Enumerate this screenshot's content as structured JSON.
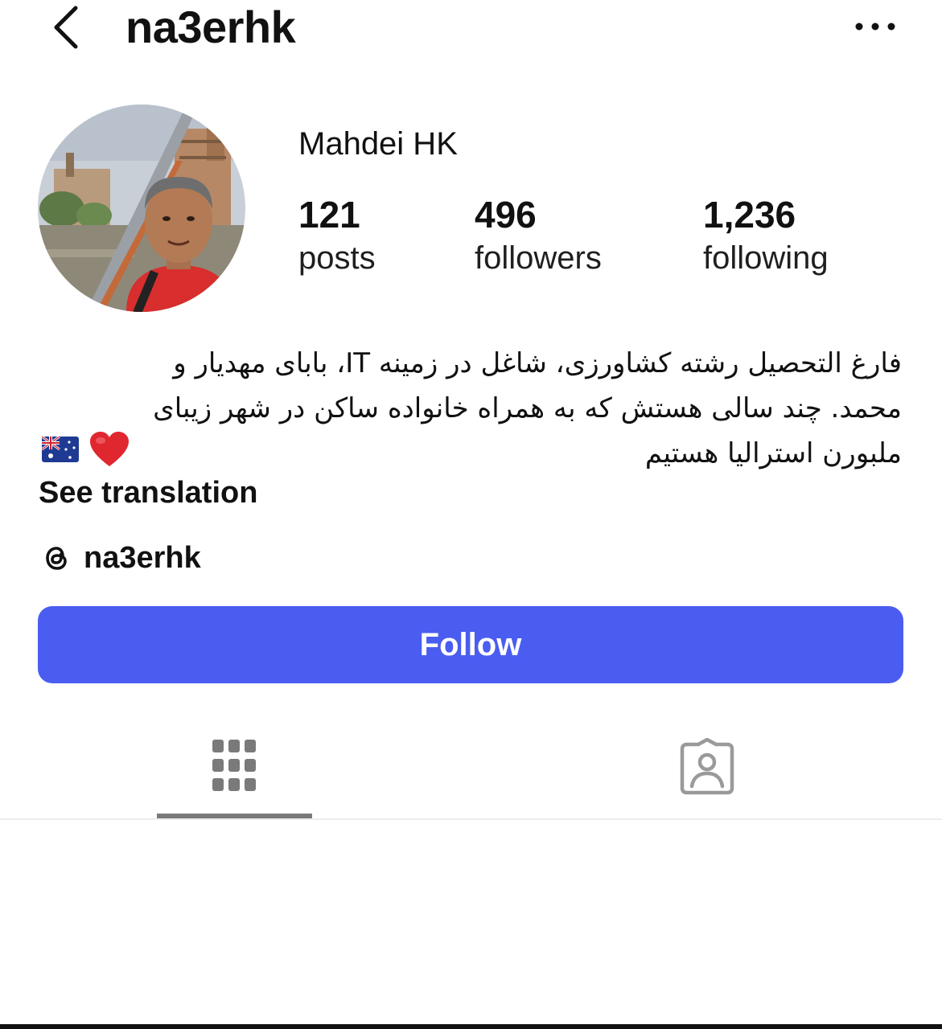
{
  "header": {
    "username": "na3erhk",
    "icons": {
      "back": "chevron-left-icon",
      "more": "more-horizontal-icon"
    }
  },
  "profile": {
    "display_name": "Mahdei HK",
    "stats": [
      {
        "value": "121",
        "label": "posts"
      },
      {
        "value": "496",
        "label": "followers"
      },
      {
        "value": "1,236",
        "label": "following"
      }
    ],
    "bio_lines": [
      "فارغ التحصیل رشته کشاورزی، شاغل در زمینه IT، بابای مهدیار و",
      "محمد. چند سالی هستش که به همراه خانواده ساکن در شهر زیبای",
      "ملبورن استرالیا هستیم"
    ],
    "bio_emojis": [
      "red-heart-emoji",
      "australia-flag-emoji"
    ],
    "see_translation": "See translation",
    "threads_handle": "na3erhk"
  },
  "actions": {
    "follow_label": "Follow"
  },
  "tabs": [
    {
      "icon": "grid-icon",
      "active": true
    },
    {
      "icon": "tagged-person-icon",
      "active": false
    }
  ],
  "colors": {
    "follow_button": "#4a5df0",
    "text": "#111111",
    "tab_icon": "#7a7a7a"
  }
}
